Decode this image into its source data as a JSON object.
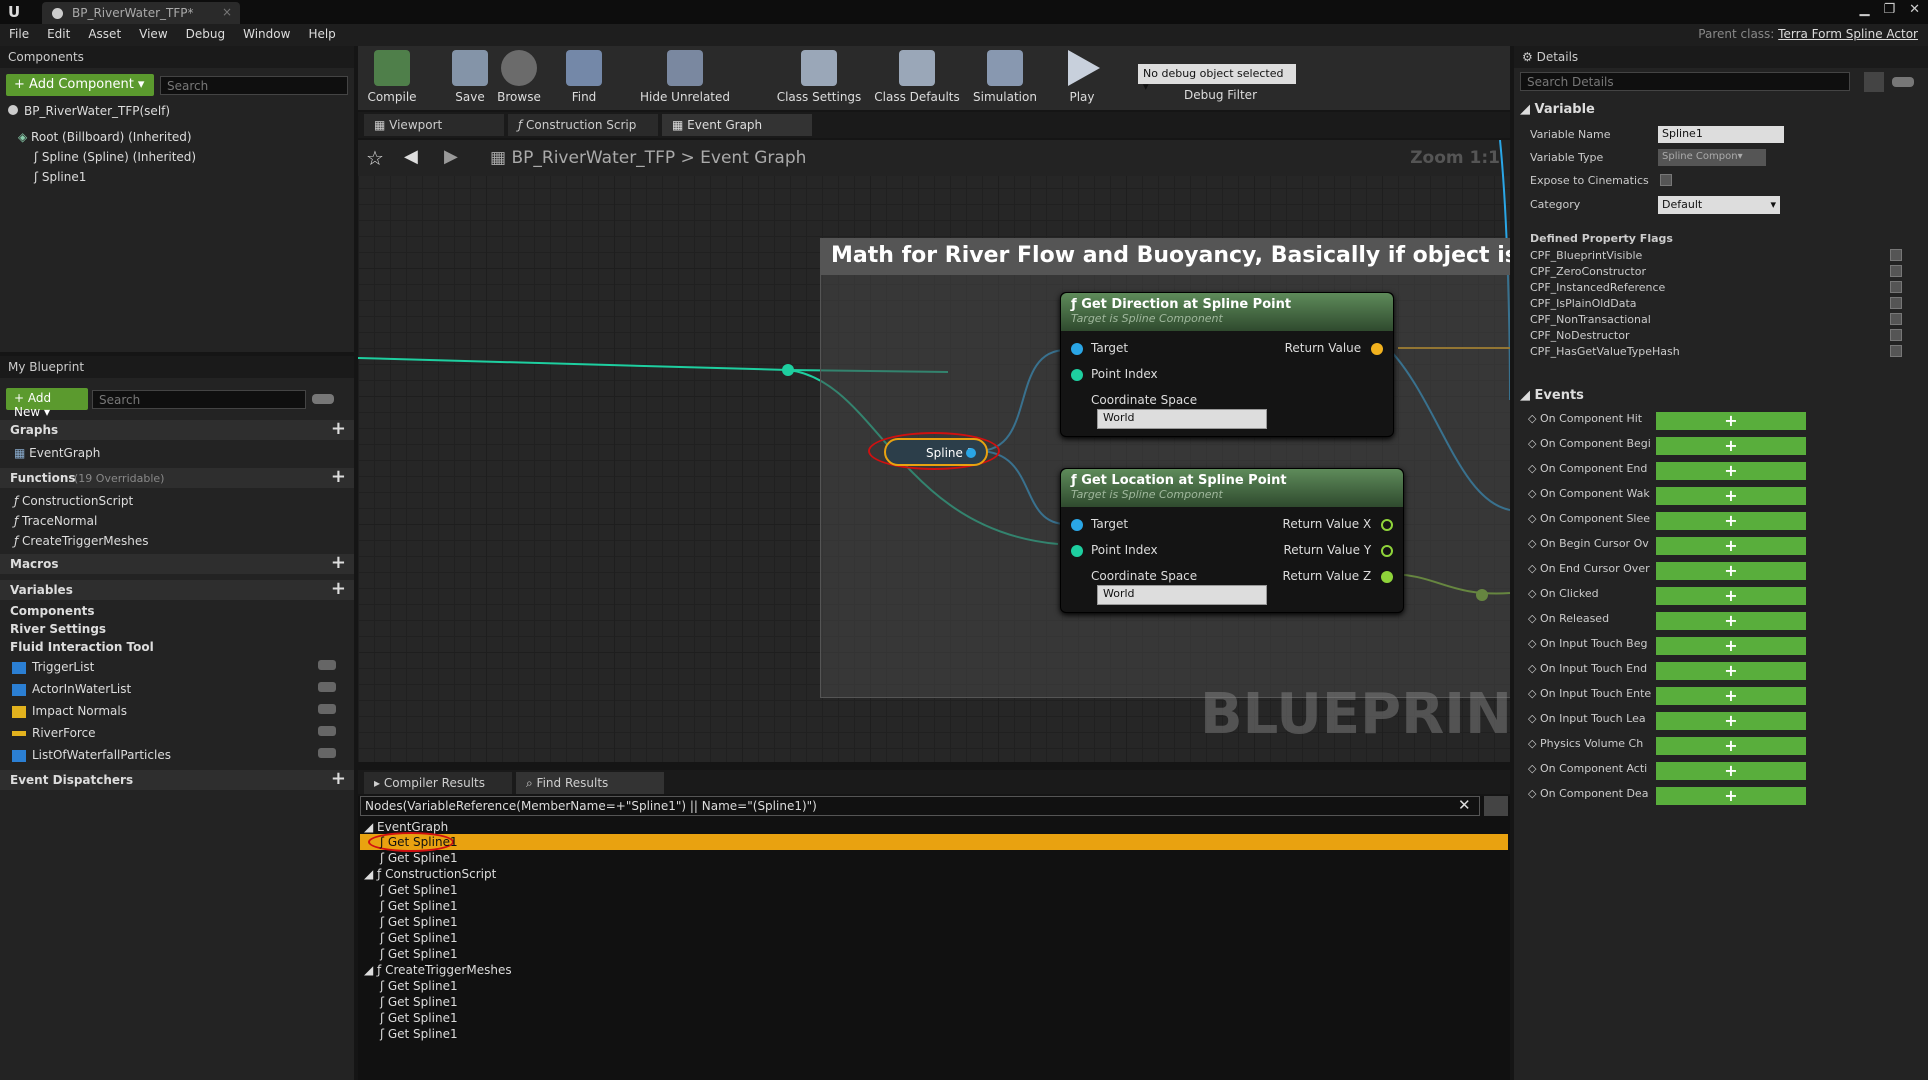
{
  "window": {
    "tab_title": "BP_RiverWater_TFP*",
    "parent_label": "Parent class:",
    "parent_class": "Terra Form Spline Actor"
  },
  "menu": [
    "File",
    "Edit",
    "Asset",
    "View",
    "Debug",
    "Window",
    "Help"
  ],
  "components": {
    "tab": "Components",
    "add_button": "+ Add Component ▾",
    "search_placeholder": "Search",
    "self": "BP_RiverWater_TFP(self)",
    "root": "Root (Billboard) (Inherited)",
    "spline_inherited": "Spline (Spline) (Inherited)",
    "spline1": "Spline1"
  },
  "blueprint": {
    "tab": "My Blueprint",
    "add_new": "+ Add New ▾",
    "search_placeholder": "Search",
    "graphs": "Graphs",
    "eventgraph": "EventGraph",
    "functions": "Functions",
    "functions_count": "(19 Overridable)",
    "fn": [
      "ConstructionScript",
      "TraceNormal",
      "CreateTriggerMeshes"
    ],
    "macros": "Macros",
    "variables": "Variables",
    "var_groups": [
      "Components",
      "River Settings",
      "Fluid Interaction Tool"
    ],
    "vars": [
      "TriggerList",
      "ActorInWaterList",
      "Impact Normals",
      "RiverForce",
      "ListOfWaterfallParticles"
    ],
    "dispatchers": "Event Dispatchers"
  },
  "toolbar": {
    "compile": "Compile",
    "save": "Save",
    "browse": "Browse",
    "find": "Find",
    "hide_unrelated": "Hide Unrelated",
    "class_settings": "Class Settings",
    "class_defaults": "Class Defaults",
    "simulation": "Simulation",
    "play": "Play",
    "debug_select": "No debug object selected ▾",
    "debug_filter": "Debug Filter"
  },
  "doc_tabs": [
    "Viewport",
    "Construction Scrip",
    "Event Graph"
  ],
  "graph": {
    "breadcrumb_bp": "BP_RiverWater_TFP",
    "breadcrumb_graph": "Event Graph",
    "zoom": "Zoom 1:1",
    "comment": "Math for River Flow and Buoyancy, Basically if object is below t",
    "watermark": "BLUEPRINT",
    "var_node": "Spline 1",
    "node1": {
      "title": "Get Direction at Spline Point",
      "sub": "Target is Spline Component",
      "target": "Target",
      "point_index": "Point Index",
      "coord": "Coordinate Space",
      "coord_val": "World",
      "ret": "Return Value"
    },
    "node2": {
      "title": "Get Location at Spline Point",
      "sub": "Target is Spline Component",
      "target": "Target",
      "point_index": "Point Index",
      "coord": "Coordinate Space",
      "coord_val": "World",
      "rx": "Return Value X",
      "ry": "Return Value Y",
      "rz": "Return Value Z"
    }
  },
  "bottom": {
    "compiler_tab": "Compiler Results",
    "find_tab": "Find Results",
    "query": "Nodes(VariableReference(MemberName=+\"Spline1\") || Name=\"(Spline1)\")",
    "eventgraph": "EventGraph",
    "construction": "ConstructionScript",
    "create": "CreateTriggerMeshes",
    "item": "Get Spline1"
  },
  "details": {
    "tab": "Details",
    "search_placeholder": "Search Details",
    "variable": "Variable",
    "var_name_label": "Variable Name",
    "var_name": "Spline1",
    "var_type_label": "Variable Type",
    "var_type": "Spline Compon▾",
    "expose": "Expose to Cinematics",
    "category_label": "Category",
    "category": "Default",
    "flags_title": "Defined Property Flags",
    "flags": [
      "CPF_BlueprintVisible",
      "CPF_ZeroConstructor",
      "CPF_InstancedReference",
      "CPF_IsPlainOldData",
      "CPF_NonTransactional",
      "CPF_NoDestructor",
      "CPF_HasGetValueTypeHash"
    ],
    "events_title": "Events",
    "events": [
      "On Component Hit",
      "On Component Begi",
      "On Component End",
      "On Component Wak",
      "On Component Slee",
      "On Begin Cursor Ov",
      "On End Cursor Over",
      "On Clicked",
      "On Released",
      "On Input Touch Beg",
      "On Input Touch End",
      "On Input Touch Ente",
      "On Input Touch Lea",
      "Physics Volume Ch",
      "On Component Acti",
      "On Component Dea"
    ]
  },
  "colors": {
    "accent_green": "#5b9a2e",
    "highlight_orange": "#e9a210",
    "pin_blue": "#2aa6e6",
    "pin_teal": "#1ecfa0",
    "pin_yellow": "#f2b21e",
    "pin_lime": "#8fd43a"
  }
}
